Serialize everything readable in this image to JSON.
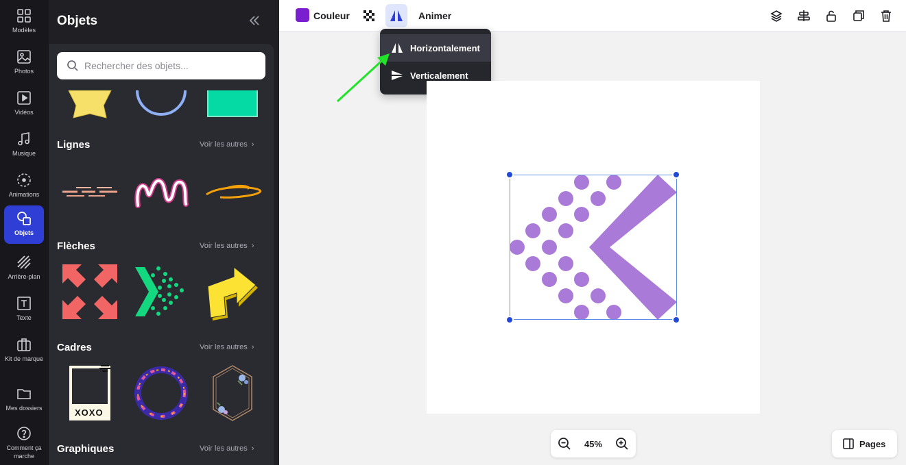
{
  "rail": {
    "items": [
      {
        "label": "Modèles",
        "icon": "templates-grid-icon"
      },
      {
        "label": "Photos",
        "icon": "photo-icon"
      },
      {
        "label": "Vidéos",
        "icon": "video-play-icon"
      },
      {
        "label": "Musique",
        "icon": "music-note-icon"
      },
      {
        "label": "Animations",
        "icon": "animation-circle-icon"
      },
      {
        "label": "Objets",
        "icon": "shapes-icon",
        "active": true
      },
      {
        "label": "Arrière-plan",
        "icon": "background-stripes-icon"
      },
      {
        "label": "Texte",
        "icon": "text-box-icon"
      },
      {
        "label": "Kit de marque",
        "icon": "briefcase-icon"
      },
      {
        "label": "Mes dossiers",
        "icon": "folder-icon"
      },
      {
        "label": "Comment ça marche",
        "icon": "help-circle-icon"
      }
    ]
  },
  "panel": {
    "title": "Objets",
    "search_placeholder": "Rechercher des objets...",
    "see_more": "Voir les autres",
    "sections": {
      "lines": "Lignes",
      "arrows": "Flèches",
      "frames": "Cadres",
      "graphics": "Graphiques"
    },
    "frame_text": "XOXO"
  },
  "toolbar": {
    "color_label": "Couleur",
    "animate_label": "Animer",
    "accent_color": "#7a1fd0"
  },
  "flip_menu": {
    "horizontal": "Horizontalement",
    "vertical": "Verticalement"
  },
  "zoom": {
    "value": "45%"
  },
  "pages_label": "Pages",
  "colors": {
    "active_rail": "#2f3fd6",
    "selection": "#5a8ee6",
    "shape_purple": "#a97ad8"
  }
}
